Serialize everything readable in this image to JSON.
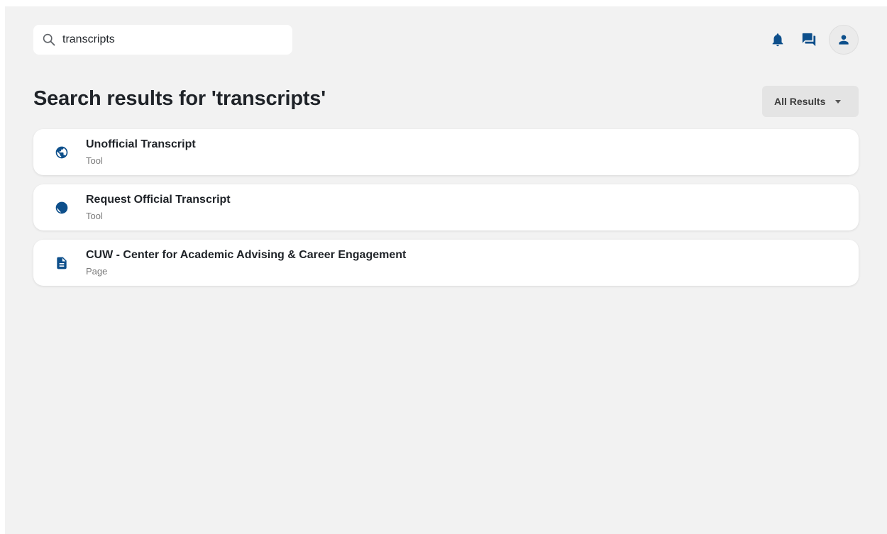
{
  "search": {
    "value": "transcripts",
    "icon": "search-icon"
  },
  "header": {
    "icons": [
      "bell-icon",
      "chat-icon",
      "person-icon"
    ]
  },
  "page": {
    "title": "Search results for 'transcripts'"
  },
  "filter": {
    "selected": "All Results"
  },
  "results": [
    {
      "title": "Unofficial Transcript",
      "type": "Tool",
      "icon": "globe-icon"
    },
    {
      "title": "Request Official Transcript",
      "type": "Tool",
      "icon": "globe-icon"
    },
    {
      "title": "CUW - Center for Academic Advising & Career Engagement",
      "type": "Page",
      "icon": "document-icon"
    }
  ],
  "colors": {
    "accent": "#0d4f8b",
    "background": "#f2f2f2",
    "card": "#ffffff"
  }
}
